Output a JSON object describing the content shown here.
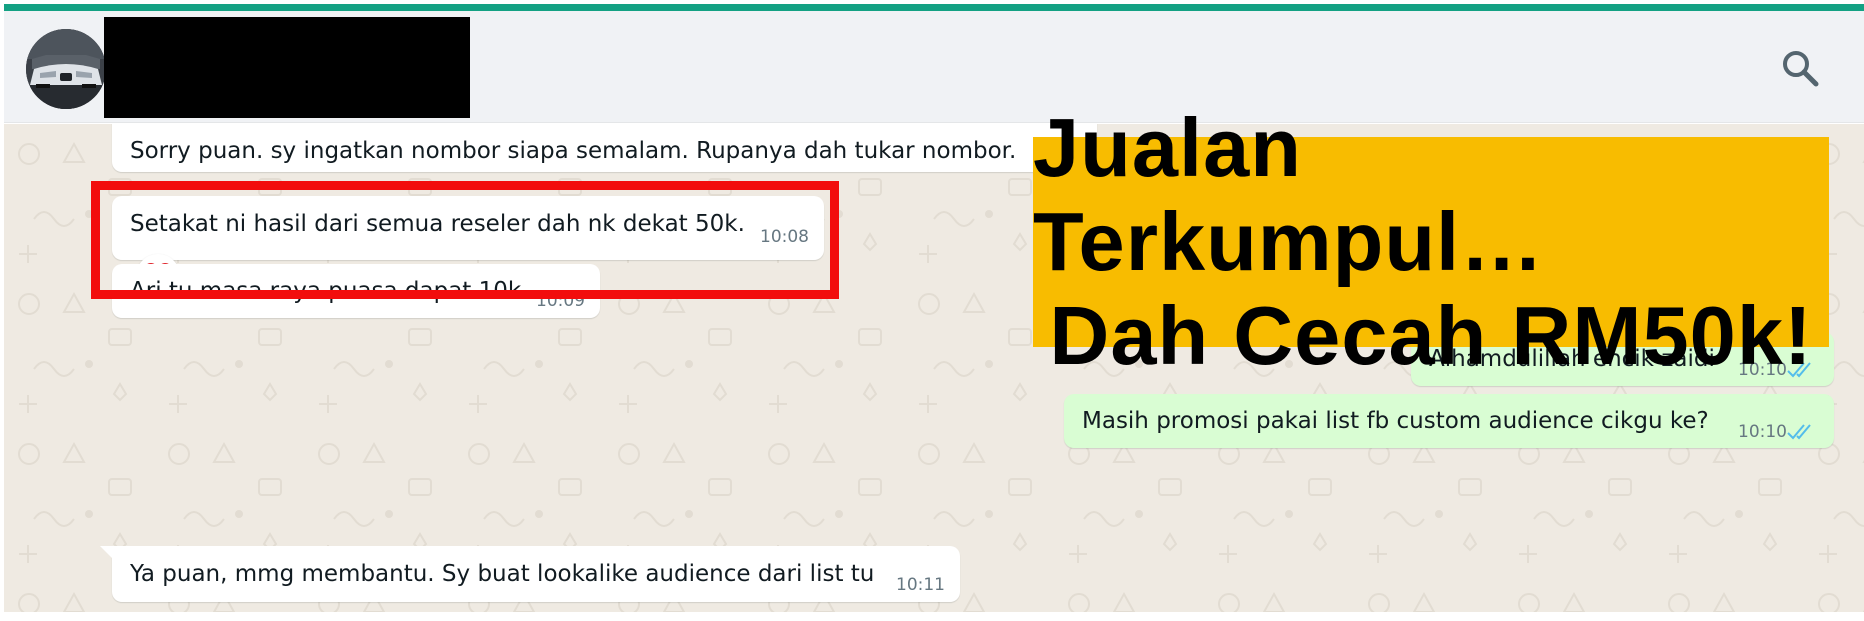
{
  "header": {
    "avatar_icon": "car-avatar",
    "search_icon": "search-icon"
  },
  "messages": [
    {
      "direction": "in",
      "text": "Sorry puan. sy ingatkan nombor siapa semalam. Rupanya dah tukar nombor.",
      "time": ""
    },
    {
      "direction": "in",
      "text": "Setakat ni hasil dari semua reseler dah nk dekat 50k.",
      "time": "10:08",
      "reaction": "❤️"
    },
    {
      "direction": "in",
      "text": "Ari tu masa raya puasa dapat 10k",
      "time": "10:09"
    },
    {
      "direction": "out",
      "text": "Alhamdulillah encik zaidi",
      "time": "10:10",
      "status": "read"
    },
    {
      "direction": "out",
      "text": "Masih promosi pakai list fb custom audience cikgu ke?",
      "time": "10:10",
      "status": "read"
    },
    {
      "direction": "in",
      "text": "Ya puan, mmg membantu. Sy buat lookalike audience dari list tu",
      "time": "10:11"
    }
  ],
  "promo_banner": {
    "line1": "Jualan Terkumpul…",
    "line2": "Dah Cecah RM50k!"
  },
  "colors": {
    "accent": "#13a183",
    "chat_background": "#efeae2",
    "incoming_bubble": "#ffffff",
    "outgoing_bubble": "#d9fdd3",
    "read_ticks": "#53bdeb",
    "highlight_box": "#f20d0d",
    "banner": "#f8bc00"
  }
}
